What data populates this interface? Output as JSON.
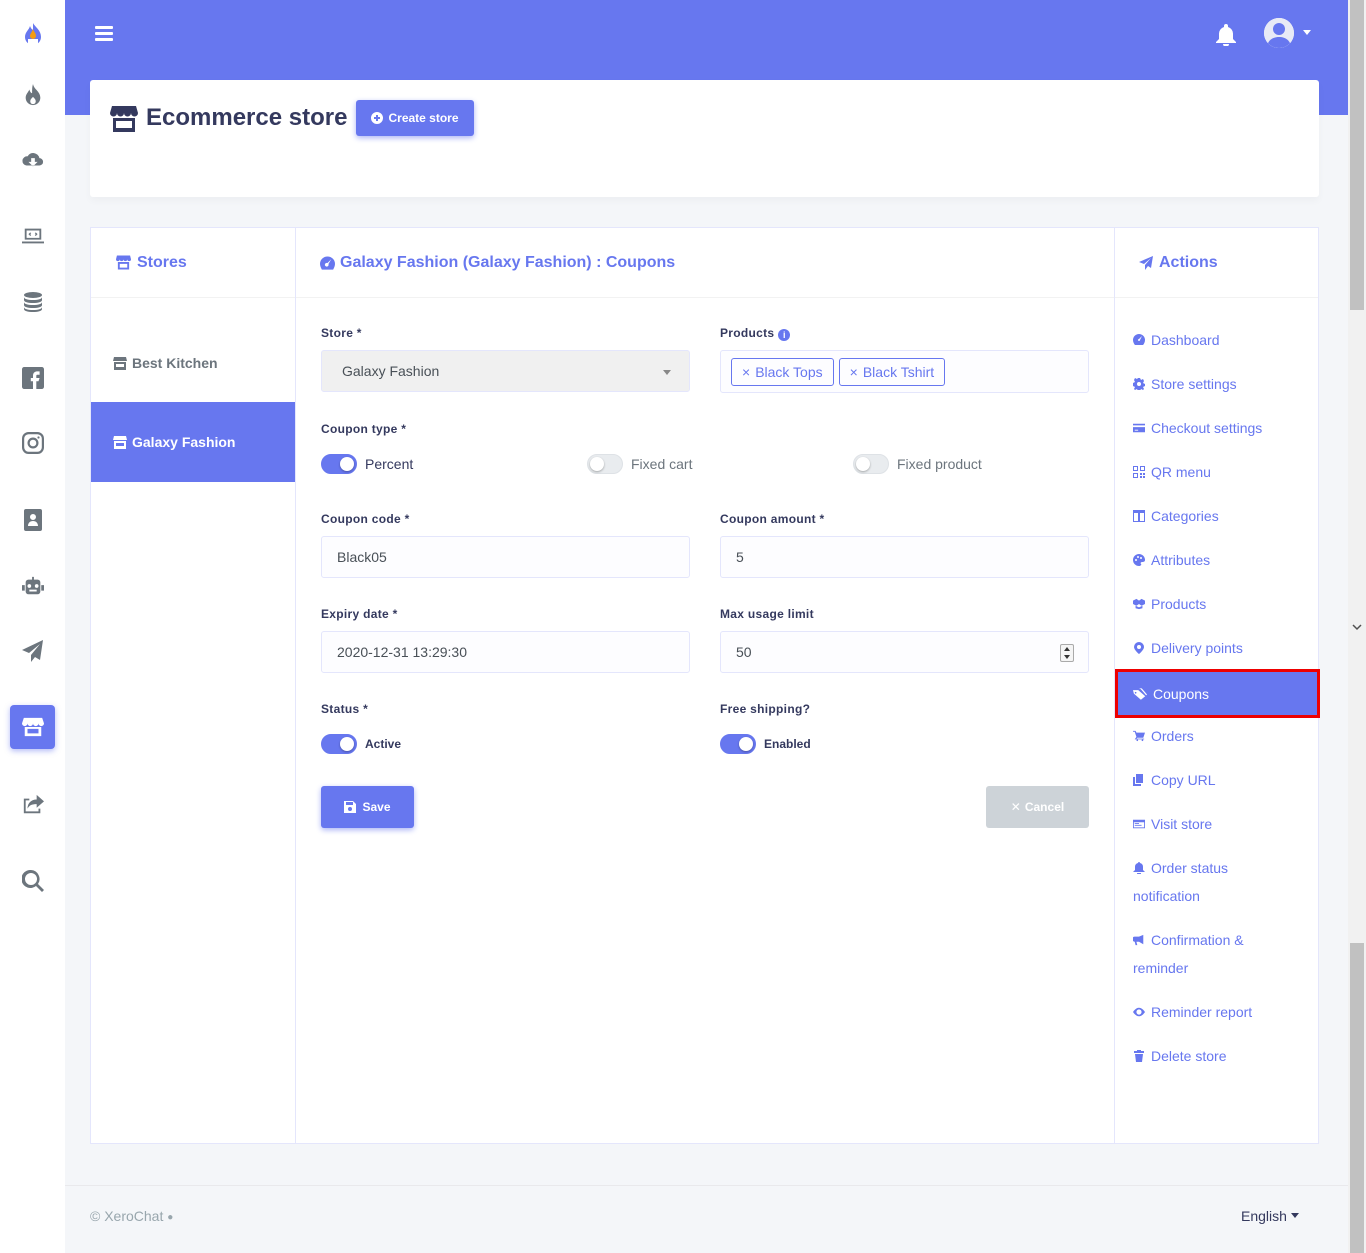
{
  "header": {
    "title": "Ecommerce store",
    "create_button": "Create store"
  },
  "stores": {
    "heading": "Stores",
    "items": [
      {
        "label": "Best Kitchen",
        "active": false
      },
      {
        "label": "Galaxy Fashion",
        "active": true
      }
    ]
  },
  "form": {
    "heading": "Galaxy Fashion (Galaxy Fashion) : Coupons",
    "store_label": "Store *",
    "store_value": "Galaxy Fashion",
    "products_label": "Products",
    "products": [
      "Black Tops",
      "Black Tshirt"
    ],
    "coupon_type_label": "Coupon type *",
    "coupon_types": [
      {
        "label": "Percent",
        "on": true
      },
      {
        "label": "Fixed cart",
        "on": false
      },
      {
        "label": "Fixed product",
        "on": false
      }
    ],
    "coupon_code_label": "Coupon code *",
    "coupon_code_value": "Black05",
    "coupon_amount_label": "Coupon amount *",
    "coupon_amount_value": "5",
    "expiry_label": "Expiry date *",
    "expiry_value": "2020-12-31 13:29:30",
    "max_usage_label": "Max usage limit",
    "max_usage_value": "50",
    "status_label": "Status *",
    "status_value": "Active",
    "free_shipping_label": "Free shipping?",
    "free_shipping_value": "Enabled",
    "save_button": "Save",
    "cancel_button": "Cancel"
  },
  "actions": {
    "heading": "Actions",
    "items": [
      {
        "label": "Dashboard",
        "icon": "tachometer-icon"
      },
      {
        "label": "Store settings",
        "icon": "gear-icon"
      },
      {
        "label": "Checkout settings",
        "icon": "credit-card-icon"
      },
      {
        "label": "QR menu",
        "icon": "qrcode-icon"
      },
      {
        "label": "Categories",
        "icon": "columns-icon"
      },
      {
        "label": "Attributes",
        "icon": "palette-icon"
      },
      {
        "label": "Products",
        "icon": "boxes-icon"
      },
      {
        "label": "Delivery points",
        "icon": "map-marker-icon"
      },
      {
        "label": "Coupons",
        "icon": "tags-icon",
        "active": true
      },
      {
        "label": "Orders",
        "icon": "cart-icon"
      },
      {
        "label": "Copy URL",
        "icon": "copy-icon"
      },
      {
        "label": "Visit store",
        "icon": "window-icon"
      },
      {
        "label": "Order status notification",
        "icon": "bell-icon"
      },
      {
        "label": "Confirmation & reminder",
        "icon": "bullhorn-icon"
      },
      {
        "label": "Reminder report",
        "icon": "eye-icon"
      },
      {
        "label": "Delete store",
        "icon": "trash-icon"
      }
    ]
  },
  "footer": {
    "copyright": "© XeroChat",
    "language": "English"
  },
  "colors": {
    "primary": "#6777ef",
    "highlight_border": "#ee0000"
  }
}
